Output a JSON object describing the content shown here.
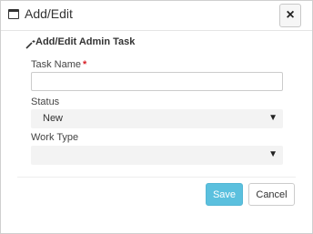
{
  "window": {
    "title": "Add/Edit",
    "close_glyph": "×",
    "icon": "window-icon"
  },
  "section": {
    "title": "Add/Edit Admin Task",
    "icon": "magic-wand-icon"
  },
  "form": {
    "task_name": {
      "label": "Task Name",
      "required_mark": "*",
      "value": "",
      "placeholder": ""
    },
    "status": {
      "label": "Status",
      "value": "New",
      "caret": "▼"
    },
    "work_type": {
      "label": "Work Type",
      "value": "",
      "caret": "▼"
    }
  },
  "buttons": {
    "save": "Save",
    "cancel": "Cancel"
  },
  "colors": {
    "save_bg": "#5bc0de",
    "required": "#d81f26"
  }
}
